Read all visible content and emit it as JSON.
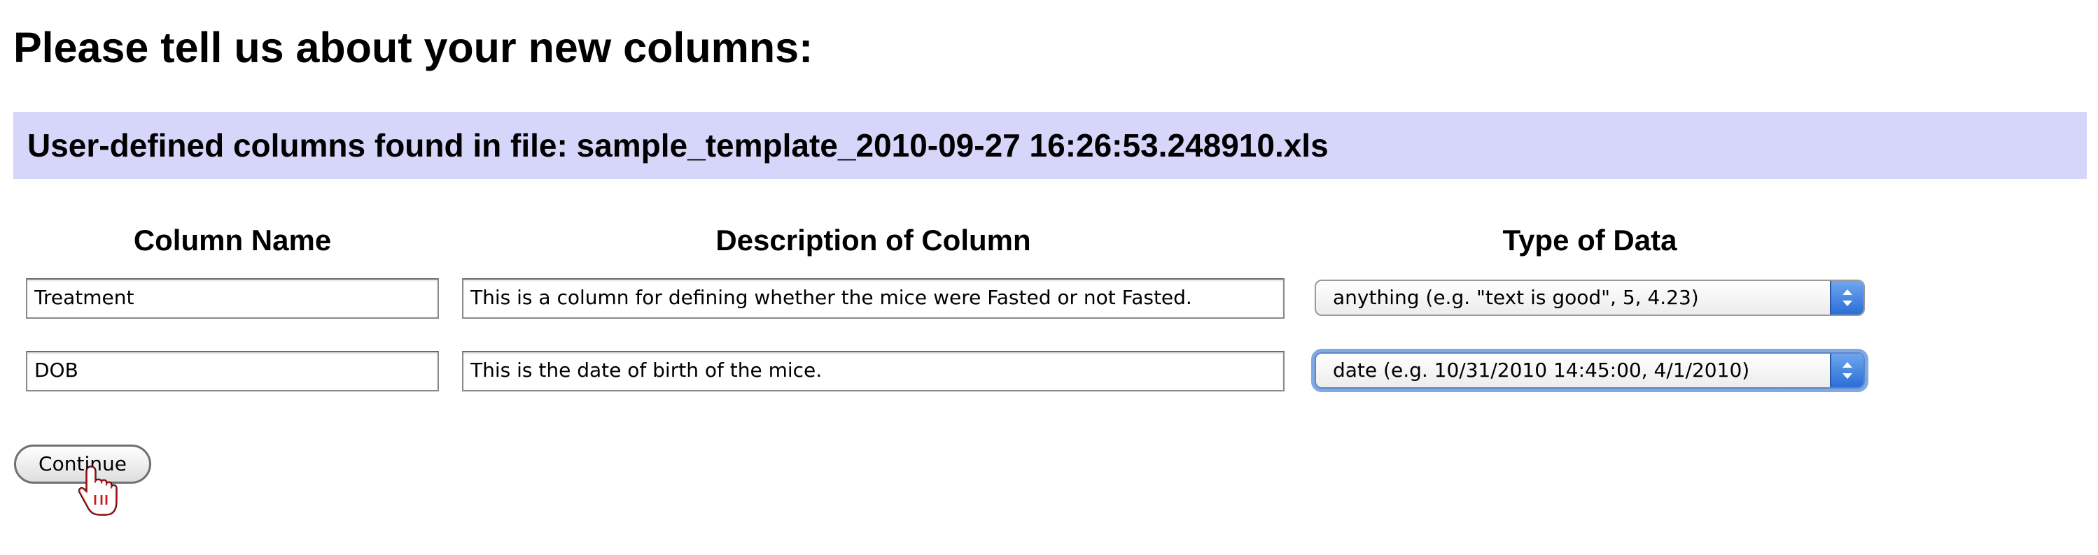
{
  "page": {
    "title": "Please tell us about your new columns:"
  },
  "file_banner": {
    "text": "User-defined columns found in file: sample_template_2010-09-27 16:26:53.248910.xls"
  },
  "table": {
    "headers": [
      "Column Name",
      "Description of Column",
      "Type of Data"
    ],
    "rows": [
      {
        "name": "Treatment",
        "description": "This is a column for defining whether the mice were Fasted or not Fasted.",
        "type": "anything (e.g. \"text is good\", 5, 4.23)"
      },
      {
        "name": "DOB",
        "description": "This is the date of birth of the mice.",
        "type": "date (e.g. 10/31/2010 14:45:00, 4/1/2010)"
      }
    ]
  },
  "actions": {
    "continue_label": "Continue"
  },
  "icons": {
    "stepper": "up-down-chevron-icon",
    "cursor": "hand-cursor-icon"
  },
  "colors": {
    "banner_bg": "#d6d6fb",
    "focus_ring": "#7fa9e5",
    "stepper_blue": "#2a6fd6"
  }
}
